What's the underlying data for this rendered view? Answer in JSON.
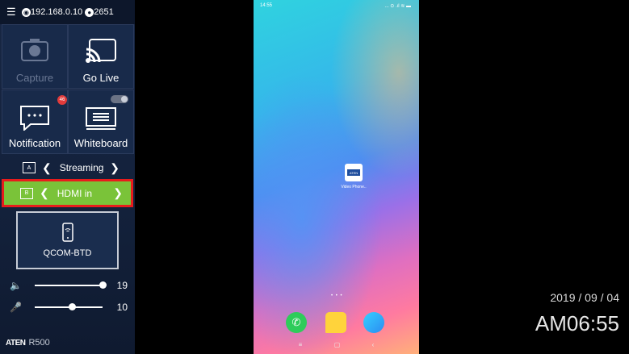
{
  "topbar": {
    "ip": "192.168.0.10",
    "count": "2651"
  },
  "tiles": {
    "capture": "Capture",
    "go_live": "Go Live",
    "notification": "Notification",
    "notification_badge": "46",
    "whiteboard": "Whiteboard"
  },
  "sources": {
    "a": {
      "tag": "A",
      "label": "Streaming"
    },
    "b": {
      "tag": "B",
      "label": "HDMI in"
    }
  },
  "device": {
    "name": "QCOM-BTD"
  },
  "sliders": {
    "volume": {
      "value": "19",
      "fraction": 1.0
    },
    "mic": {
      "value": "10",
      "fraction": 0.55
    }
  },
  "footer": {
    "brand": "ATEN",
    "model": "R500"
  },
  "phone": {
    "status_time": "14:55",
    "status_icons": "... ⊙ .ıl ≋ ▬",
    "app_label": "Video Phone..",
    "app_logo": "ATEN"
  },
  "clock": {
    "date": "2019 / 09 / 04",
    "time": "AM06:55"
  },
  "colors": {
    "accent_green": "#7ac339",
    "highlight_red": "#e81c1c",
    "sidebar_bg": "#182744"
  }
}
